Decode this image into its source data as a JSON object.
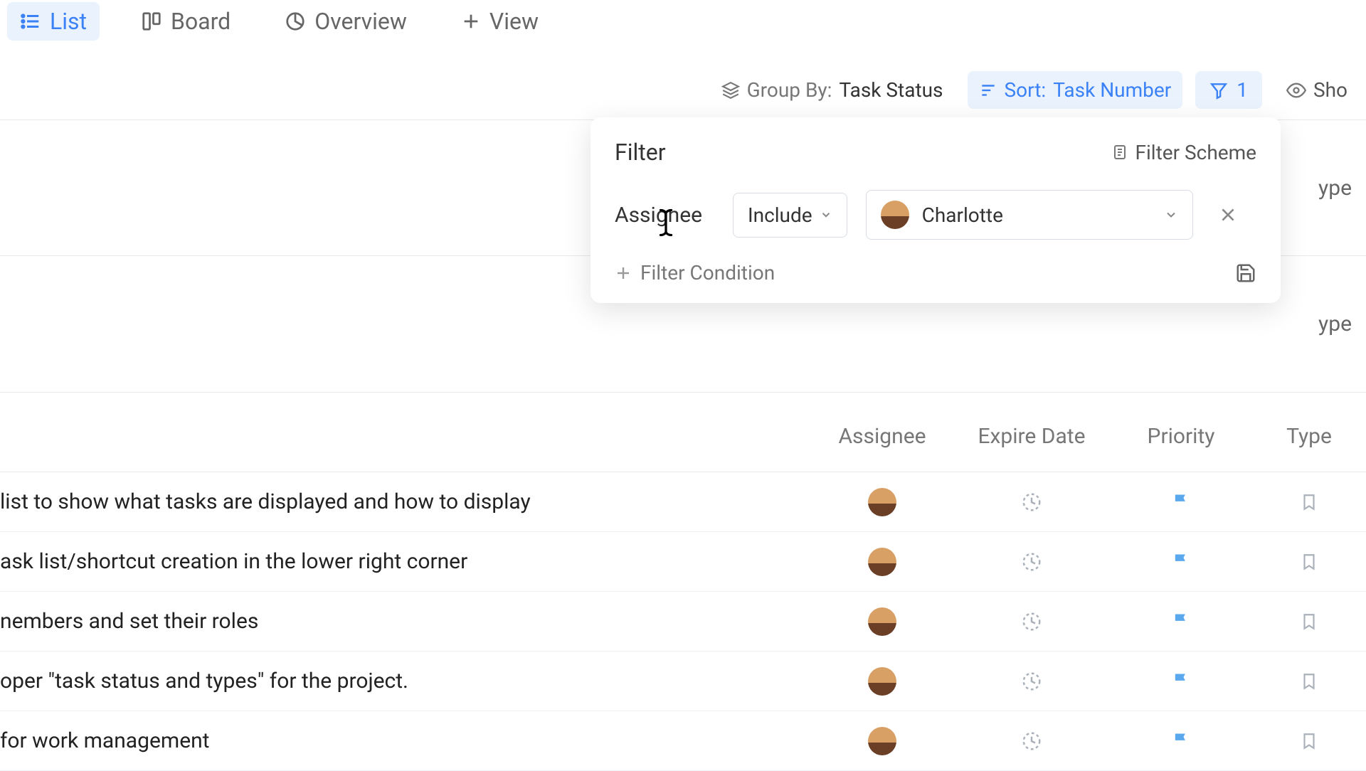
{
  "tabs": [
    {
      "label": "List",
      "active": true
    },
    {
      "label": "Board",
      "active": false
    },
    {
      "label": "Overview",
      "active": false
    },
    {
      "label": "View",
      "active": false
    }
  ],
  "toolbar": {
    "group_by_label": "Group By:",
    "group_by_value": "Task Status",
    "sort_label": "Sort:",
    "sort_value": "Task Number",
    "filter_count": "1",
    "show_label": "Sho"
  },
  "filter_popover": {
    "title": "Filter",
    "scheme_label": "Filter Scheme",
    "row": {
      "field": "Assignee",
      "operator": "Include",
      "value_name": "Charlotte"
    },
    "add_condition": "Filter Condition"
  },
  "background_rows": {
    "type_label_1": "ype",
    "type_label_2": "ype"
  },
  "table": {
    "headers": {
      "assignee": "Assignee",
      "expire": "Expire Date",
      "priority": "Priority",
      "type": "Type"
    },
    "rows": [
      {
        "title": "list to show what tasks are displayed and how to display"
      },
      {
        "title": "ask list/shortcut creation in the lower right corner"
      },
      {
        "title": "nembers and set their roles"
      },
      {
        "title": "oper \"task status and types\" for the project."
      },
      {
        "title": "for work management"
      }
    ]
  }
}
